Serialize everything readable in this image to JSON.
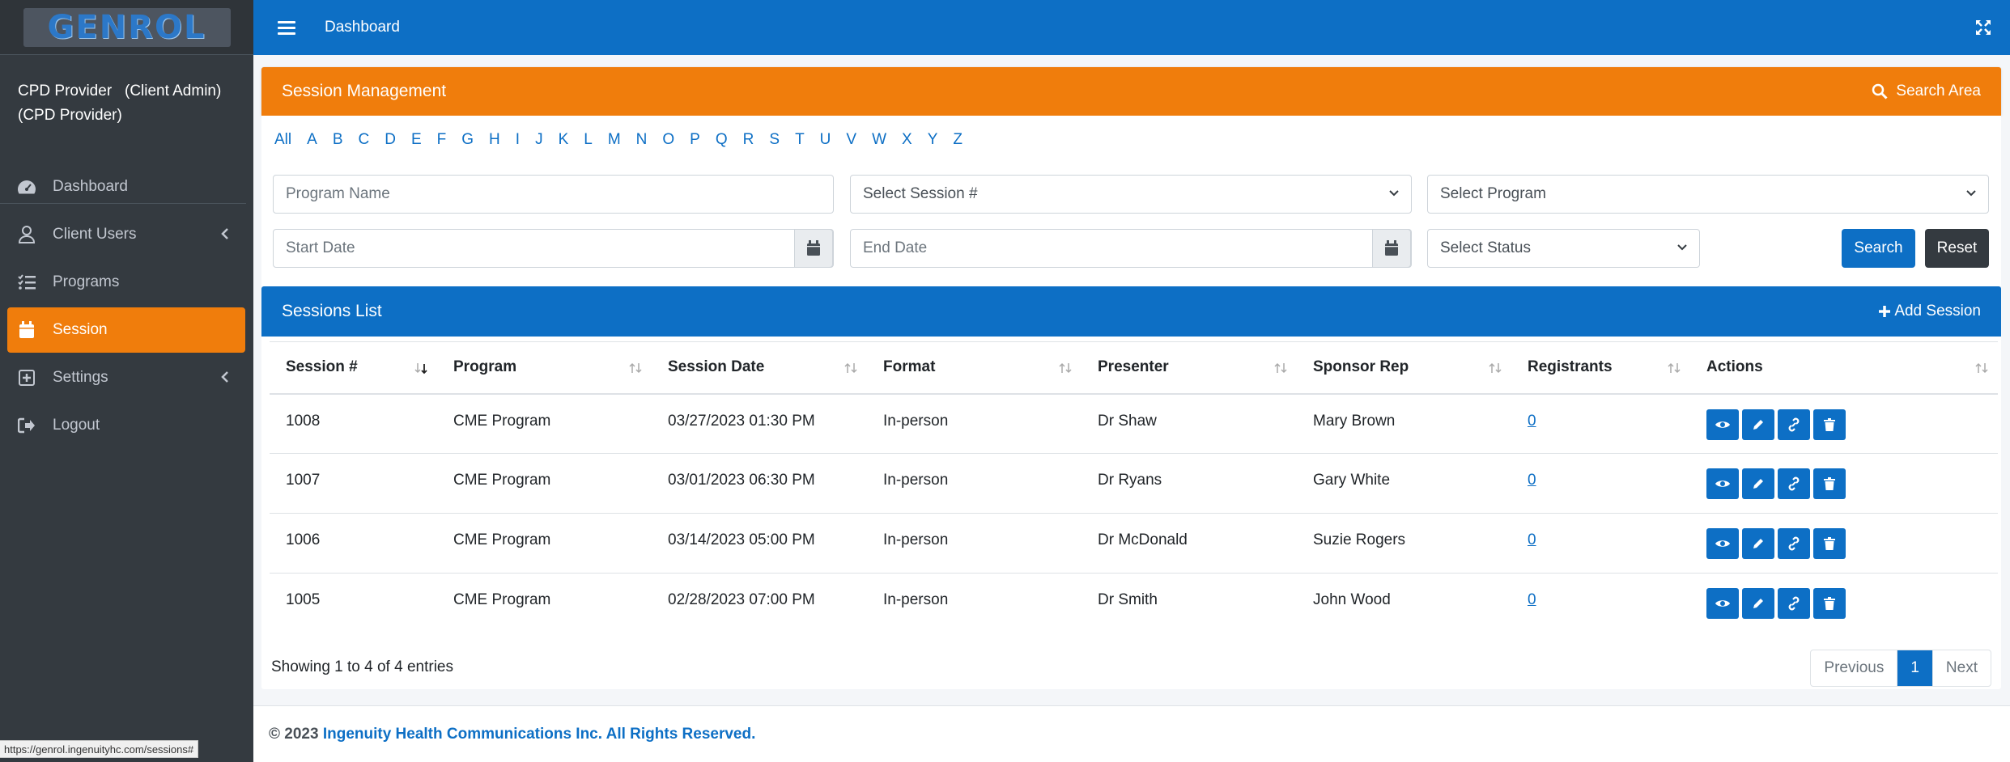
{
  "brand": {
    "logo_text": "GENROL"
  },
  "user": {
    "name": "CPD Provider",
    "role_label": "(Client Admin)",
    "org": "(CPD Provider)"
  },
  "sidebar": {
    "items": [
      {
        "label": "Dashboard",
        "icon": "dashboard-icon"
      },
      {
        "label": "Client Users",
        "icon": "user-icon"
      },
      {
        "label": "Programs",
        "icon": "list-icon"
      },
      {
        "label": "Session",
        "icon": "calendar-icon",
        "active": true
      },
      {
        "label": "Settings",
        "icon": "plus-square-icon"
      },
      {
        "label": "Logout",
        "icon": "logout-icon"
      }
    ]
  },
  "status_bar": {
    "url": "https://genrol.ingenuityhc.com/sessions#"
  },
  "header": {
    "title": "Dashboard"
  },
  "session_management": {
    "title": "Session Management",
    "search_area_label": "Search Area",
    "alphabet": [
      "All",
      "A",
      "B",
      "C",
      "D",
      "E",
      "F",
      "G",
      "H",
      "I",
      "J",
      "K",
      "L",
      "M",
      "N",
      "O",
      "P",
      "Q",
      "R",
      "S",
      "T",
      "U",
      "V",
      "W",
      "X",
      "Y",
      "Z"
    ],
    "program_name_placeholder": "Program Name",
    "session_select": "Select Session #",
    "program_select": "Select Program",
    "start_date_placeholder": "Start Date",
    "end_date_placeholder": "End Date",
    "status_select": "Select Status",
    "search_label": "Search",
    "reset_label": "Reset"
  },
  "sessions_list": {
    "title": "Sessions List",
    "add_label": "Add Session",
    "columns": [
      "Session #",
      "Program",
      "Session Date",
      "Format",
      "Presenter",
      "Sponsor Rep",
      "Registrants",
      "Actions"
    ],
    "rows": [
      {
        "session": "1008",
        "program": "CME Program",
        "date": "03/27/2023 01:30 PM",
        "format": "In-person",
        "presenter": "Dr Shaw",
        "sponsor": "Mary Brown",
        "registrants": "0"
      },
      {
        "session": "1007",
        "program": "CME Program",
        "date": "03/01/2023 06:30 PM",
        "format": "In-person",
        "presenter": "Dr Ryans",
        "sponsor": "Gary White",
        "registrants": "0"
      },
      {
        "session": "1006",
        "program": "CME Program",
        "date": "03/14/2023 05:00 PM",
        "format": "In-person",
        "presenter": "Dr McDonald",
        "sponsor": "Suzie Rogers",
        "registrants": "0"
      },
      {
        "session": "1005",
        "program": "CME Program",
        "date": "02/28/2023 07:00 PM",
        "format": "In-person",
        "presenter": "Dr Smith",
        "sponsor": "John Wood",
        "registrants": "0"
      }
    ],
    "showing": "Showing 1 to 4 of 4 entries",
    "pagination": {
      "previous": "Previous",
      "current": "1",
      "next": "Next"
    }
  },
  "footer": {
    "prefix": "© 2023",
    "company": "Ingenuity Health Communications Inc. All Rights Reserved."
  },
  "colors": {
    "primary": "#0d6fc5",
    "accent": "#f07d0c",
    "sidebar": "#343a40",
    "dark_button": "#343a40"
  }
}
